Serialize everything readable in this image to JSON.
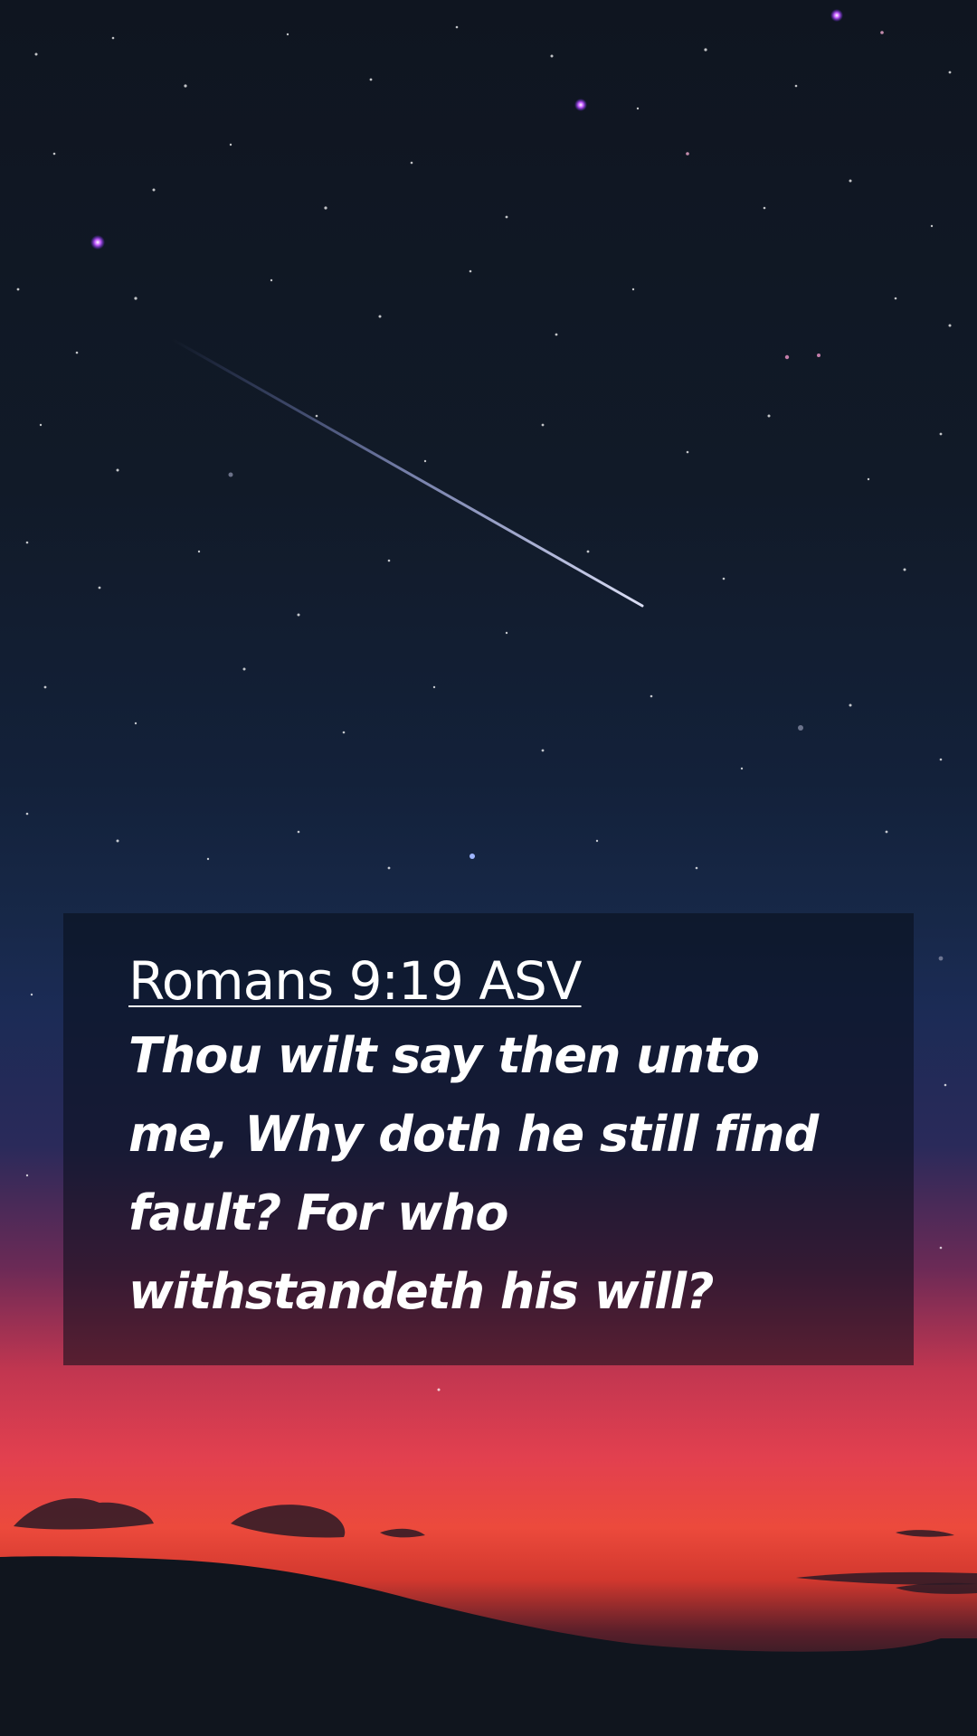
{
  "verse": {
    "reference": "Romans 9:19 ASV",
    "text": "Thou wilt say then unto me, Why doth he still find fault? For who withstandeth his will?"
  },
  "colors": {
    "sky_top": "#0f1520",
    "sky_mid": "#172848",
    "horizon_glow": "#ec4a3c",
    "ground": "#0e141c",
    "text": "#ffffff",
    "overlay": "rgba(8, 12, 24, 0.55)"
  }
}
